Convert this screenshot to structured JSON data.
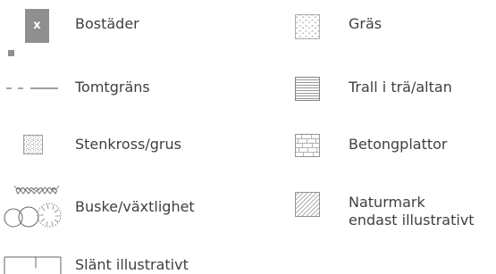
{
  "legend": {
    "items": [
      {
        "key": "bostader",
        "label": "Bostäder",
        "symbol_text": "x",
        "symbol_icon": "house-symbol-icon"
      },
      {
        "key": "tomtgrans",
        "label": "Tomtgräns",
        "symbol_icon": "property-boundary-line-icon"
      },
      {
        "key": "stenkross",
        "label": "Stenkross/grus",
        "symbol_icon": "gravel-pattern-icon"
      },
      {
        "key": "buske",
        "label": "Buske/växtlighet",
        "symbol_icon": "shrub-icon"
      },
      {
        "key": "slant",
        "label": "Slänt illustrativt",
        "symbol_icon": "slope-icon"
      },
      {
        "key": "gras",
        "label": "Gräs",
        "symbol_icon": "grass-pattern-icon"
      },
      {
        "key": "trall",
        "label": "Trall i trä/altan",
        "symbol_icon": "wood-deck-pattern-icon"
      },
      {
        "key": "betong",
        "label": "Betongplattor",
        "symbol_icon": "concrete-tiles-pattern-icon"
      },
      {
        "key": "naturmark",
        "label_line1": "Naturmark",
        "label_line2": "endast illustrativt",
        "symbol_icon": "natural-ground-hatch-icon"
      }
    ]
  },
  "colors": {
    "text": "#3f3f3f",
    "house_fill": "#8f8f8f",
    "symbol_stroke": "#666666",
    "pattern_gray": "#9a9a9a"
  }
}
